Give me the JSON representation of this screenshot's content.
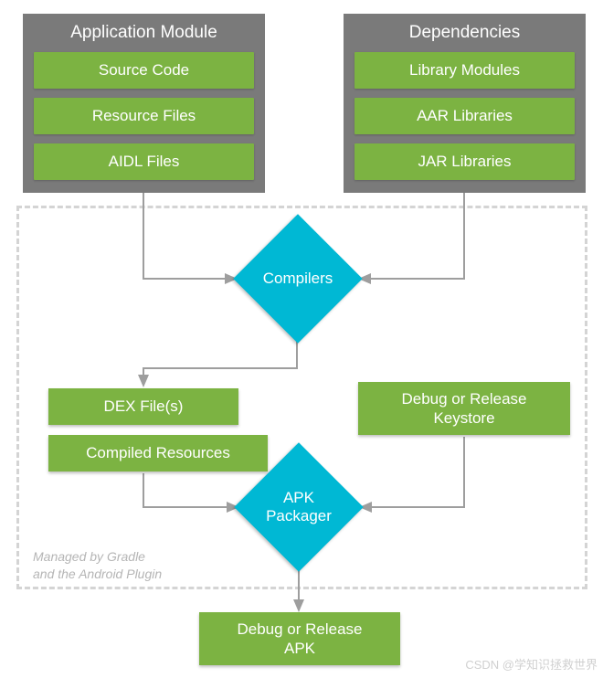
{
  "diagram": {
    "appModule": {
      "title": "Application Module",
      "items": [
        "Source Code",
        "Resource Files",
        "AIDL Files"
      ]
    },
    "dependencies": {
      "title": "Dependencies",
      "items": [
        "Library Modules",
        "AAR Libraries",
        "JAR Libraries"
      ]
    },
    "compilers": "Compilers",
    "dexFiles": "DEX File(s)",
    "compiledResources": "Compiled Resources",
    "keystore": "Debug or Release\nKeystore",
    "apkPackager": "APK\nPackager",
    "apkOutput": "Debug or Release\nAPK",
    "managedNote": "Managed by Gradle\nand the Android Plugin",
    "watermark": "CSDN @学知识拯救世界"
  },
  "chart_data": {
    "type": "flowchart",
    "nodes": [
      {
        "id": "app_module",
        "type": "container",
        "label": "Application Module",
        "children": [
          "source_code",
          "resource_files",
          "aidl_files"
        ]
      },
      {
        "id": "source_code",
        "type": "item",
        "label": "Source Code"
      },
      {
        "id": "resource_files",
        "type": "item",
        "label": "Resource Files"
      },
      {
        "id": "aidl_files",
        "type": "item",
        "label": "AIDL Files"
      },
      {
        "id": "dependencies",
        "type": "container",
        "label": "Dependencies",
        "children": [
          "library_modules",
          "aar_libraries",
          "jar_libraries"
        ]
      },
      {
        "id": "library_modules",
        "type": "item",
        "label": "Library Modules"
      },
      {
        "id": "aar_libraries",
        "type": "item",
        "label": "AAR Libraries"
      },
      {
        "id": "jar_libraries",
        "type": "item",
        "label": "JAR Libraries"
      },
      {
        "id": "compilers",
        "type": "process-decision",
        "label": "Compilers"
      },
      {
        "id": "dex_files",
        "type": "item",
        "label": "DEX File(s)"
      },
      {
        "id": "compiled_resources",
        "type": "item",
        "label": "Compiled Resources"
      },
      {
        "id": "keystore",
        "type": "item",
        "label": "Debug or Release Keystore"
      },
      {
        "id": "apk_packager",
        "type": "process-decision",
        "label": "APK Packager"
      },
      {
        "id": "apk_output",
        "type": "item",
        "label": "Debug or Release APK"
      }
    ],
    "edges": [
      {
        "from": "app_module",
        "to": "compilers"
      },
      {
        "from": "dependencies",
        "to": "compilers"
      },
      {
        "from": "compilers",
        "to": "dex_files"
      },
      {
        "from": "compilers",
        "to": "compiled_resources"
      },
      {
        "from": "dex_files",
        "to": "apk_packager"
      },
      {
        "from": "compiled_resources",
        "to": "apk_packager"
      },
      {
        "from": "keystore",
        "to": "apk_packager"
      },
      {
        "from": "apk_packager",
        "to": "apk_output"
      }
    ],
    "annotations": [
      {
        "text": "Managed by Gradle and the Android Plugin",
        "applies_to": [
          "compilers",
          "dex_files",
          "compiled_resources",
          "keystore",
          "apk_packager"
        ]
      }
    ],
    "colors": {
      "container": "#7a7a7a",
      "item": "#7cb342",
      "process": "#00b8d4",
      "dashed_border": "#d4d4d4"
    }
  }
}
